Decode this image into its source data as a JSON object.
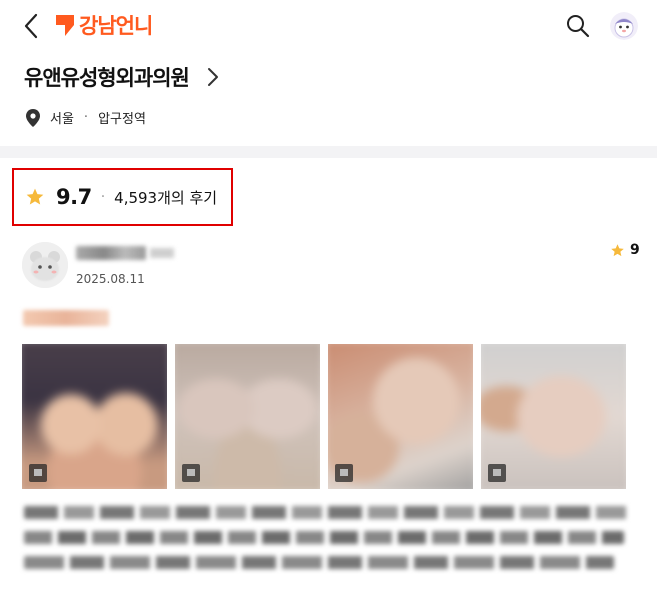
{
  "header": {
    "logo_text": "강남언니",
    "brand_color": "#ff5a1f",
    "icons": [
      "chevron-left-icon",
      "logo-icon",
      "search-icon",
      "avatar"
    ]
  },
  "clinic": {
    "name": "유앤유성형외과의원",
    "location_city": "서울",
    "location_separator": "·",
    "location_area": "압구정역"
  },
  "rating": {
    "score": "9.7",
    "separator": "·",
    "review_count": "4,593개의 후기",
    "star_color": "#f6b93b",
    "highlight_border_color": "#e00000"
  },
  "review": {
    "date": "2025.08.11",
    "score": "9",
    "photo_count": 4
  }
}
